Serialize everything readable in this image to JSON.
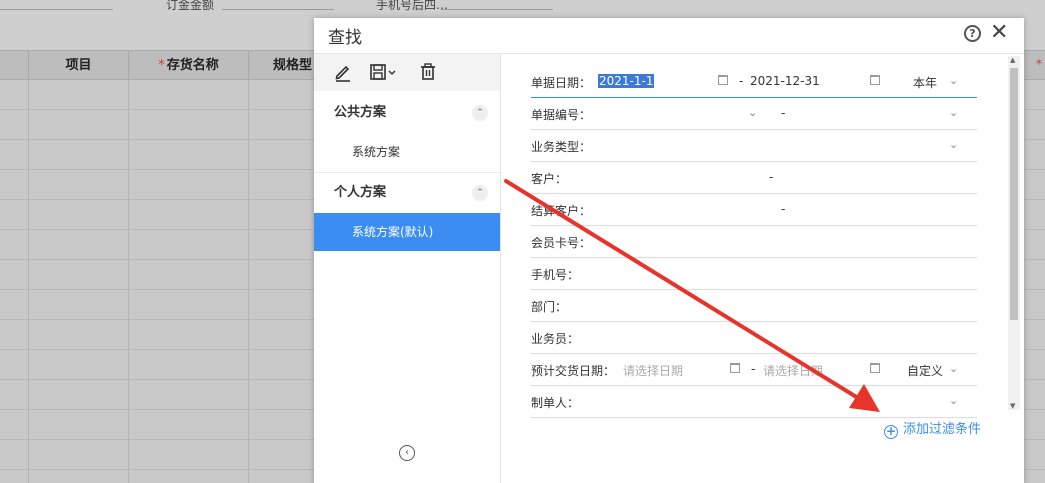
{
  "background": {
    "fields": [
      "订金金额",
      "手机号后四…"
    ],
    "columns": [
      "项目",
      "存货名称",
      "规格型"
    ],
    "required_marker": "*"
  },
  "dialog": {
    "title": "查找",
    "help_icon": "help-icon",
    "close_icon": "close-icon",
    "help_glyph": "?",
    "close_glyph": "✕"
  },
  "sidebar": {
    "sections": [
      {
        "label": "公共方案",
        "items": [
          "系统方案"
        ]
      },
      {
        "label": "个人方案",
        "items": [
          "系统方案(默认)"
        ]
      }
    ],
    "toggle_glyph": "⌃",
    "collapse_glyph": "‹"
  },
  "form": {
    "doc_date_label": "单据日期：",
    "doc_date_from": "2021-1-1",
    "doc_date_to": "2021-12-31",
    "doc_date_range": "本年",
    "doc_no_label": "单据编号：",
    "biz_type_label": "业务类型：",
    "customer_label": "客户：",
    "settle_customer_label": "结算客户：",
    "member_card_label": "会员卡号：",
    "phone_label": "手机号：",
    "department_label": "部门：",
    "salesperson_label": "业务员：",
    "delivery_date_label": "预计交货日期：",
    "date_placeholder": "请选择日期",
    "delivery_range": "自定义",
    "creator_label": "制单人：",
    "dash": "-",
    "chevron": "⌄"
  },
  "add_filter_label": "添加过滤条件",
  "add_filter_glyph": "+",
  "colors": {
    "accent": "#3b8df2",
    "arrow": "#e8332a"
  }
}
